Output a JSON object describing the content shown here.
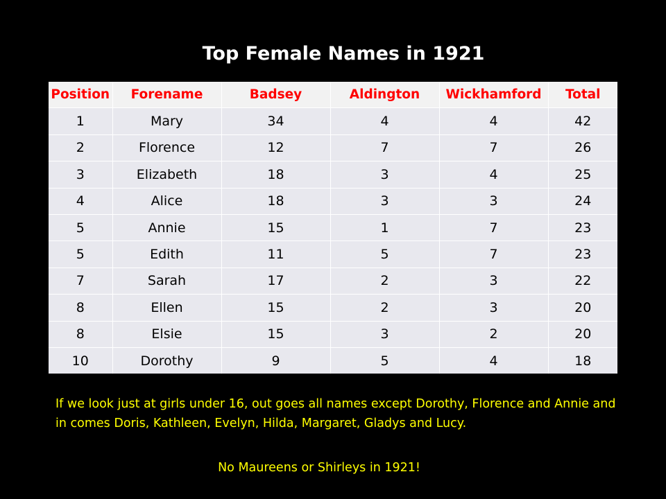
{
  "title": "Top Female Names in 1921",
  "colors": {
    "background": "#000000",
    "title": "#ffffff",
    "header_text": "#ff0000",
    "note_text": "#ffff00",
    "row_fill": "#e8e8ee"
  },
  "chart_data": {
    "type": "table",
    "title": "Top Female Names in 1921",
    "columns": [
      "Position",
      "Forename",
      "Badsey",
      "Aldington",
      "Wickhamford",
      "Total"
    ],
    "rows": [
      [
        "1",
        "Mary",
        "34",
        "4",
        "4",
        "42"
      ],
      [
        "2",
        "Florence",
        "12",
        "7",
        "7",
        "26"
      ],
      [
        "3",
        "Elizabeth",
        "18",
        "3",
        "4",
        "25"
      ],
      [
        "4",
        "Alice",
        "18",
        "3",
        "3",
        "24"
      ],
      [
        "5",
        "Annie",
        "15",
        "1",
        "7",
        "23"
      ],
      [
        "5",
        "Edith",
        "11",
        "5",
        "7",
        "23"
      ],
      [
        "7",
        "Sarah",
        "17",
        "2",
        "3",
        "22"
      ],
      [
        "8",
        "Ellen",
        "15",
        "2",
        "3",
        "20"
      ],
      [
        "8",
        "Elsie",
        "15",
        "3",
        "2",
        "20"
      ],
      [
        "10",
        "Dorothy",
        "9",
        "5",
        "4",
        "18"
      ]
    ]
  },
  "notes": {
    "paragraph": "If we look just at girls under 16, out goes all names except Dorothy, Florence and Annie and in comes Doris, Kathleen, Evelyn, Hilda, Margaret, Gladys and Lucy.",
    "closing": "No Maureens or Shirleys in 1921!"
  }
}
